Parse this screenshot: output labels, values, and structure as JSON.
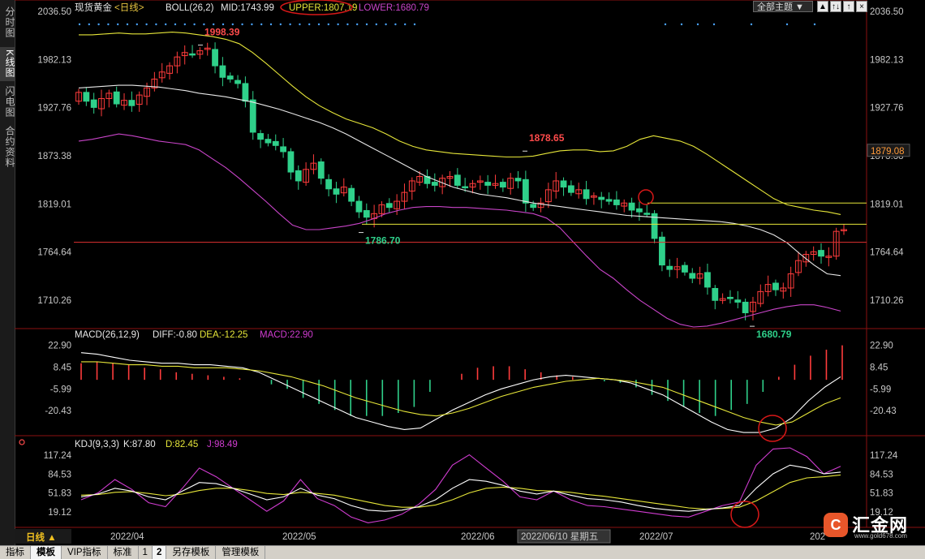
{
  "sidebar": {
    "tabs": [
      {
        "label": "分时图",
        "active": false
      },
      {
        "label": "K线图",
        "active": true
      },
      {
        "label": "闪电图",
        "active": false
      },
      {
        "label": "合约资料",
        "active": false
      }
    ]
  },
  "header": {
    "instrument": "现货黄金",
    "period_tag": "<日线>",
    "boll_params": "BOLL(26,2)",
    "mid_label": "MID:1743.99",
    "upper_label": "UPPER:1807.19",
    "lower_label": "LOWER:1680.79",
    "theme_button": "全部主题"
  },
  "window_buttons": [
    "▲",
    "↑↓",
    "↑",
    "×"
  ],
  "colors": {
    "up": "#ff3c3c",
    "down": "#2fd08a",
    "mid": "#e8e8e8",
    "upper": "#e6e639",
    "lower": "#c844c8",
    "price_axis": "#ff4b4b",
    "dea": "#e6e639",
    "macd": "#d03cd0",
    "kdj_k": "#ffffff",
    "kdj_d": "#e6e639",
    "kdj_j": "#d03cd0",
    "grid": "#8b1010",
    "annotation": "#d81818"
  },
  "main_axis": [
    "2036.50",
    "1982.13",
    "1927.76",
    "1873.38",
    "1819.01",
    "1764.64",
    "1710.26"
  ],
  "price_tag": "1879.08",
  "highlow_labels": [
    {
      "text": "1998.39",
      "kind": "high"
    },
    {
      "text": "1878.65",
      "kind": "high"
    },
    {
      "text": "1786.70",
      "kind": "low"
    },
    {
      "text": "1680.79",
      "kind": "low"
    }
  ],
  "macd": {
    "title": "MACD(26,12,9)",
    "diff_label": "DIFF:-0.80",
    "dea_label": "DEA:-12.25",
    "macd_label": "MACD:22.90",
    "axis": [
      "22.90",
      "8.45",
      "-5.99",
      "-20.43"
    ]
  },
  "kdj": {
    "title": "KDJ(9,3,3)",
    "k_label": "K:87.80",
    "d_label": "D:82.45",
    "j_label": "J:98.49",
    "axis": [
      "117.24",
      "84.53",
      "51.83",
      "19.12"
    ]
  },
  "dates": {
    "period_button": "日线 ▲",
    "labels": [
      "2022/04",
      "2022/05",
      "2022/06",
      "2022/07",
      "202"
    ],
    "highlighted": "2022/06/10 星期五"
  },
  "toolbar": {
    "items": [
      "指标",
      "模板",
      "VIP指标",
      "标准",
      "1",
      "2",
      "另存模板",
      "管理模板"
    ],
    "active": [
      "模板",
      "2"
    ]
  },
  "logo": {
    "icon_char": "C",
    "name": "汇金网",
    "url": "www.gold678.com"
  },
  "chart_data": [
    {
      "type": "candlestick",
      "title": "",
      "indicator": "BOLL(26,2)",
      "ylim": [
        1680,
        2036.5
      ],
      "notable_prices": {
        "high_1": 1998.39,
        "high_2": 1878.65,
        "low_1": 1786.7,
        "low_2": 1680.79
      },
      "closes": [
        1945,
        1935,
        1928,
        1938,
        1944,
        1932,
        1936,
        1930,
        1942,
        1950,
        1960,
        1968,
        1975,
        1985,
        1990,
        1988,
        1992,
        1995,
        1975,
        1962,
        1960,
        1955,
        1935,
        1900,
        1892,
        1888,
        1885,
        1878,
        1855,
        1845,
        1858,
        1865,
        1848,
        1836,
        1830,
        1838,
        1822,
        1810,
        1804,
        1808,
        1818,
        1815,
        1822,
        1832,
        1845,
        1850,
        1842,
        1840,
        1848,
        1850,
        1840,
        1838,
        1842,
        1845,
        1840,
        1842,
        1838,
        1848,
        1845,
        1820,
        1815,
        1820,
        1835,
        1845,
        1838,
        1832,
        1835,
        1825,
        1828,
        1824,
        1822,
        1818,
        1820,
        1812,
        1810,
        1808,
        1780,
        1750,
        1745,
        1748,
        1742,
        1735,
        1740,
        1725,
        1710,
        1712,
        1712,
        1708,
        1696,
        1708,
        1720,
        1728,
        1722,
        1724,
        1740,
        1755,
        1762,
        1765,
        1760,
        1760,
        1788,
        1790
      ],
      "boll_mid": [
        1950,
        1951,
        1952,
        1953,
        1953,
        1952,
        1951,
        1949,
        1947,
        1944,
        1942,
        1940,
        1937,
        1934,
        1930,
        1926,
        1921,
        1916,
        1911,
        1905,
        1898,
        1890,
        1882,
        1874,
        1866,
        1858,
        1850,
        1844,
        1838,
        1834,
        1830,
        1828,
        1826,
        1823,
        1820,
        1818,
        1816,
        1814,
        1812,
        1810,
        1808,
        1806,
        1805,
        1804,
        1803,
        1802,
        1801,
        1800,
        1799,
        1797,
        1794,
        1790,
        1784,
        1775,
        1762,
        1750,
        1740,
        1738
      ],
      "boll_upper": [
        2010,
        2010,
        2011,
        2012,
        2011,
        2011,
        2012,
        2013,
        2012,
        2010,
        2008,
        2005,
        2000,
        1990,
        1978,
        1965,
        1952,
        1940,
        1930,
        1922,
        1915,
        1910,
        1905,
        1898,
        1890,
        1884,
        1880,
        1878,
        1876,
        1875,
        1874,
        1873,
        1872,
        1872,
        1873,
        1876,
        1879,
        1880,
        1880,
        1878,
        1879,
        1884,
        1892,
        1896,
        1893,
        1890,
        1884,
        1875,
        1865,
        1855,
        1845,
        1835,
        1825,
        1818,
        1815,
        1812,
        1810,
        1807
      ],
      "boll_lower": [
        1890,
        1892,
        1895,
        1898,
        1896,
        1893,
        1890,
        1888,
        1886,
        1880,
        1870,
        1860,
        1848,
        1835,
        1822,
        1808,
        1795,
        1790,
        1790,
        1792,
        1794,
        1797,
        1802,
        1808,
        1812,
        1815,
        1816,
        1816,
        1815,
        1815,
        1814,
        1813,
        1812,
        1810,
        1808,
        1803,
        1792,
        1776,
        1760,
        1745,
        1735,
        1722,
        1710,
        1700,
        1690,
        1683,
        1680,
        1681,
        1684,
        1688,
        1692,
        1696,
        1700,
        1703,
        1705,
        1705,
        1702,
        1698
      ]
    },
    {
      "type": "bar+line",
      "indicator": "MACD(26,12,9)",
      "ylim": [
        -36,
        27
      ],
      "diff": [
        18,
        17,
        15,
        13,
        12,
        11,
        11,
        10,
        10,
        9,
        8,
        5,
        0,
        -5,
        -10,
        -15,
        -20,
        -25,
        -28,
        -31,
        -33,
        -32,
        -26,
        -20,
        -15,
        -10,
        -6,
        -3,
        0,
        2,
        3,
        2,
        1,
        0,
        -2,
        -6,
        -10,
        -16,
        -22,
        -28,
        -33,
        -35,
        -35,
        -32,
        -25,
        -14,
        -5,
        2
      ],
      "dea": [
        12,
        12,
        11,
        10,
        10,
        9,
        9,
        8,
        8,
        8,
        7,
        6,
        4,
        2,
        -1,
        -4,
        -8,
        -12,
        -15,
        -18,
        -21,
        -23,
        -24,
        -22,
        -19,
        -15,
        -11,
        -8,
        -5,
        -3,
        -1,
        0,
        1,
        0,
        -1,
        -3,
        -5,
        -9,
        -13,
        -17,
        -21,
        -25,
        -28,
        -30,
        -28,
        -22,
        -16,
        -12
      ],
      "macd": [
        11,
        12,
        11,
        10,
        8,
        7,
        5,
        4,
        3,
        2,
        1,
        0,
        -3,
        -6,
        -12,
        -16,
        -20,
        -24,
        -24,
        -24,
        -22,
        -18,
        -8,
        0,
        4,
        8,
        9,
        9,
        7,
        5,
        3,
        2,
        0,
        -1,
        -2,
        -5,
        -10,
        -14,
        -18,
        -22,
        -24,
        -20,
        -16,
        -8,
        2,
        10,
        16,
        20,
        22.9
      ]
    },
    {
      "type": "line",
      "indicator": "KDJ(9,3,3)",
      "ylim": [
        -5,
        130
      ],
      "k": [
        45,
        50,
        60,
        55,
        45,
        40,
        55,
        70,
        68,
        60,
        50,
        40,
        45,
        60,
        48,
        42,
        30,
        22,
        20,
        22,
        28,
        40,
        60,
        75,
        72,
        65,
        55,
        50,
        55,
        48,
        42,
        40,
        36,
        30,
        25,
        22,
        20,
        23,
        26,
        30,
        60,
        85,
        100,
        95,
        85,
        88
      ],
      "d": [
        48,
        49,
        53,
        54,
        51,
        47,
        50,
        56,
        60,
        60,
        56,
        51,
        49,
        53,
        51,
        48,
        42,
        36,
        30,
        27,
        27,
        31,
        40,
        52,
        60,
        62,
        60,
        56,
        55,
        53,
        49,
        46,
        42,
        38,
        34,
        30,
        26,
        24,
        25,
        27,
        38,
        54,
        70,
        78,
        80,
        83
      ],
      "j": [
        40,
        52,
        75,
        58,
        35,
        28,
        60,
        95,
        80,
        60,
        40,
        20,
        38,
        75,
        42,
        30,
        10,
        0,
        5,
        15,
        32,
        58,
        100,
        118,
        95,
        72,
        45,
        40,
        55,
        40,
        30,
        28,
        24,
        20,
        16,
        12,
        10,
        20,
        30,
        36,
        100,
        128,
        130,
        115,
        85,
        98
      ]
    }
  ]
}
